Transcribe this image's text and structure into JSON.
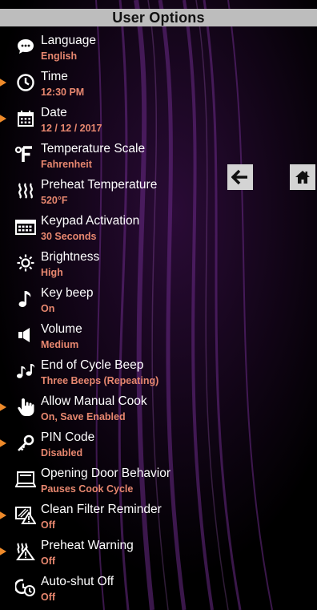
{
  "header": {
    "title": "User Options"
  },
  "nav": {
    "back_icon": "arrow-left-icon",
    "home_icon": "home-icon"
  },
  "colors": {
    "value_text": "#e7876f",
    "pointer": "#ee8a2a",
    "header_bg": "#bdbdbd"
  },
  "items": [
    {
      "label": "Language",
      "value": "English",
      "icon": "speech-bubble-icon",
      "pointer": false
    },
    {
      "label": "Time",
      "value": "12:30 PM",
      "icon": "clock-icon",
      "pointer": true
    },
    {
      "label": "Date",
      "value": "12 / 12 / 2017",
      "icon": "calendar-icon",
      "pointer": true
    },
    {
      "label": "Temperature Scale",
      "value": "Fahrenheit",
      "icon": "degree-f-icon",
      "pointer": false
    },
    {
      "label": "Preheat Temperature",
      "value": "520°F",
      "icon": "heat-waves-icon",
      "pointer": false
    },
    {
      "label": "Keypad Activation",
      "value": "30 Seconds",
      "icon": "keypad-icon",
      "pointer": false
    },
    {
      "label": "Brightness",
      "value": "High",
      "icon": "sun-icon",
      "pointer": false
    },
    {
      "label": "Key beep",
      "value": "On",
      "icon": "music-note-icon",
      "pointer": false
    },
    {
      "label": "Volume",
      "value": "Medium",
      "icon": "speaker-icon",
      "pointer": false
    },
    {
      "label": "End of Cycle Beep",
      "value": "Three Beeps (Repeating)",
      "icon": "double-note-icon",
      "pointer": false
    },
    {
      "label": "Allow Manual Cook",
      "value": "On, Save Enabled",
      "icon": "hand-pointer-icon",
      "pointer": true
    },
    {
      "label": "PIN Code",
      "value": "Disabled",
      "icon": "key-icon",
      "pointer": true
    },
    {
      "label": "Opening Door Behavior",
      "value": "Pauses Cook Cycle",
      "icon": "oven-door-icon",
      "pointer": false
    },
    {
      "label": "Clean Filter Reminder",
      "value": "Off",
      "icon": "filter-warning-icon",
      "pointer": true
    },
    {
      "label": "Preheat Warning",
      "value": "Off",
      "icon": "heat-warning-icon",
      "pointer": true
    },
    {
      "label": "Auto-shut Off",
      "value": "Off",
      "icon": "auto-off-clock-icon",
      "pointer": false
    }
  ]
}
